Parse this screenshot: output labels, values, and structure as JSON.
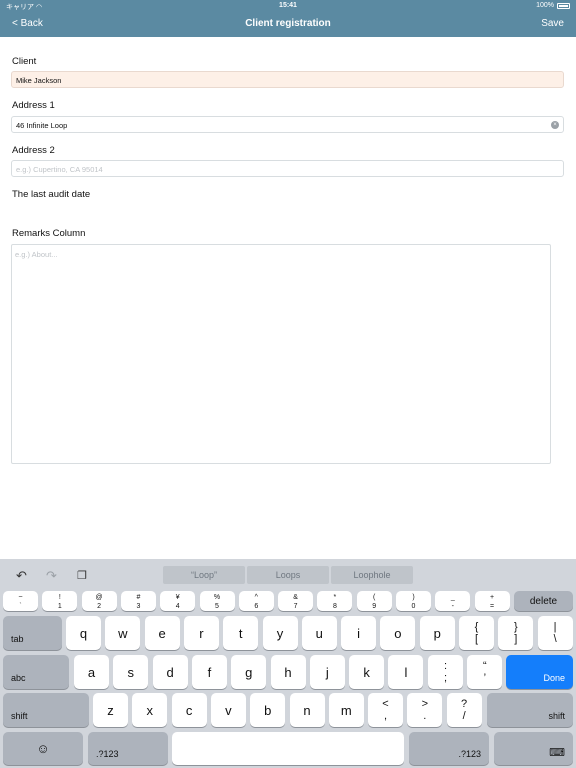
{
  "status": {
    "carrier": "キャリア",
    "time": "15:41",
    "battery": "100%"
  },
  "nav": {
    "back": "< Back",
    "title": "Client registration",
    "save": "Save"
  },
  "form": {
    "client_label": "Client",
    "client_value": "Mike Jackson",
    "address1_label": "Address 1",
    "address1_value": "46 Infinite Loop",
    "address2_label": "Address 2",
    "address2_placeholder": "e.g.) Cupertino, CA 95014",
    "audit_label": "The last audit date",
    "remarks_label": "Remarks Column",
    "remarks_placeholder": "e.g.)  About..."
  },
  "keyboard": {
    "suggestions": [
      "“Loop”",
      "Loops",
      "Loophole"
    ],
    "number_row": [
      {
        "top": "~",
        "bottom": "`"
      },
      {
        "top": "!",
        "bottom": "1"
      },
      {
        "top": "@",
        "bottom": "2"
      },
      {
        "top": "#",
        "bottom": "3"
      },
      {
        "top": "¥",
        "bottom": "4"
      },
      {
        "top": "%",
        "bottom": "5"
      },
      {
        "top": "^",
        "bottom": "6"
      },
      {
        "top": "&",
        "bottom": "7"
      },
      {
        "top": "*",
        "bottom": "8"
      },
      {
        "top": "(",
        "bottom": "9"
      },
      {
        "top": ")",
        "bottom": "0"
      },
      {
        "top": "_",
        "bottom": "-"
      },
      {
        "top": "+",
        "bottom": "="
      }
    ],
    "delete": "delete",
    "tab": "tab",
    "row_q": [
      "q",
      "w",
      "e",
      "r",
      "t",
      "y",
      "u",
      "i",
      "o",
      "p"
    ],
    "row_q_extra": [
      {
        "top": "{",
        "bottom": "["
      },
      {
        "top": "}",
        "bottom": "]"
      },
      {
        "top": "|",
        "bottom": "\\"
      }
    ],
    "abc": "abc",
    "row_a": [
      "a",
      "s",
      "d",
      "f",
      "g",
      "h",
      "j",
      "k",
      "l"
    ],
    "row_a_extra": [
      {
        "top": ":",
        "bottom": ";"
      },
      {
        "top": "“",
        "bottom": "’"
      }
    ],
    "done": "Done",
    "shift": "shift",
    "row_z": [
      "z",
      "x",
      "c",
      "v",
      "b",
      "n",
      "m"
    ],
    "row_z_extra": [
      {
        "top": "<",
        "bottom": ","
      },
      {
        "top": ">",
        "bottom": "."
      },
      {
        "top": "?",
        "bottom": "/"
      }
    ],
    "num_mode": ".?123"
  }
}
